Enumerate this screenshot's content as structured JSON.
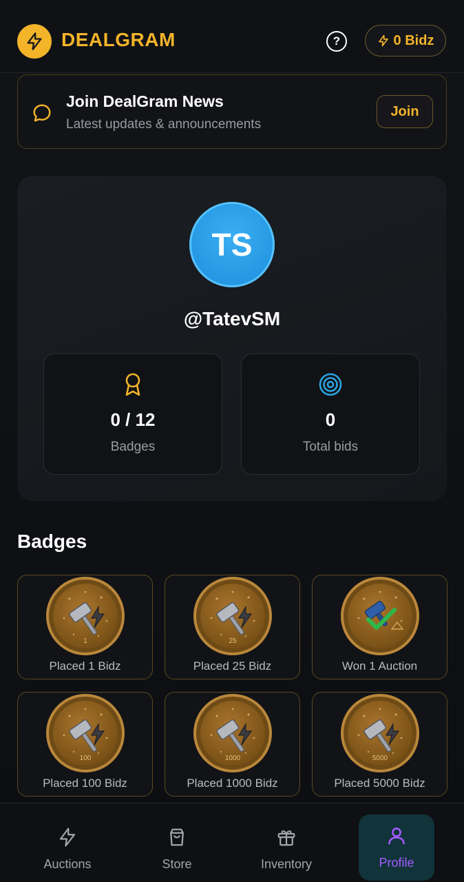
{
  "header": {
    "logo_text": "DEALGRAM",
    "help_glyph": "?",
    "bidz_label": "0 Bidz"
  },
  "news": {
    "title": "Join DealGram News",
    "subtitle": "Latest updates & announcements",
    "join_label": "Join"
  },
  "profile": {
    "avatar_initials": "TS",
    "username": "@TatevSM",
    "stats": [
      {
        "value": "0 / 12",
        "label": "Badges",
        "icon": "ribbon-icon"
      },
      {
        "value": "0",
        "label": "Total bids",
        "icon": "target-icon"
      }
    ]
  },
  "badges": {
    "title": "Badges",
    "items": [
      {
        "label": "Placed 1 Bidz",
        "medal_number": "1",
        "type": "gavel"
      },
      {
        "label": "Placed 25 Bidz",
        "medal_number": "25",
        "type": "gavel"
      },
      {
        "label": "Won 1 Auction",
        "medal_number": "",
        "type": "won"
      },
      {
        "label": "Placed 100 Bidz",
        "medal_number": "100",
        "type": "gavel"
      },
      {
        "label": "Placed 1000 Bidz",
        "medal_number": "1000",
        "type": "gavel"
      },
      {
        "label": "Placed 5000 Bidz",
        "medal_number": "5000",
        "type": "gavel"
      }
    ]
  },
  "nav": {
    "items": [
      {
        "label": "Auctions",
        "icon": "bolt-icon",
        "active": false
      },
      {
        "label": "Store",
        "icon": "shopping-bag-icon",
        "active": false
      },
      {
        "label": "Inventory",
        "icon": "gift-icon",
        "active": false
      },
      {
        "label": "Profile",
        "icon": "user-icon",
        "active": true
      }
    ]
  },
  "colors": {
    "accent": "#f3b42a",
    "avatar": "#2196e8",
    "active_nav": "#a35cff",
    "target_icon": "#2aa3e0"
  }
}
